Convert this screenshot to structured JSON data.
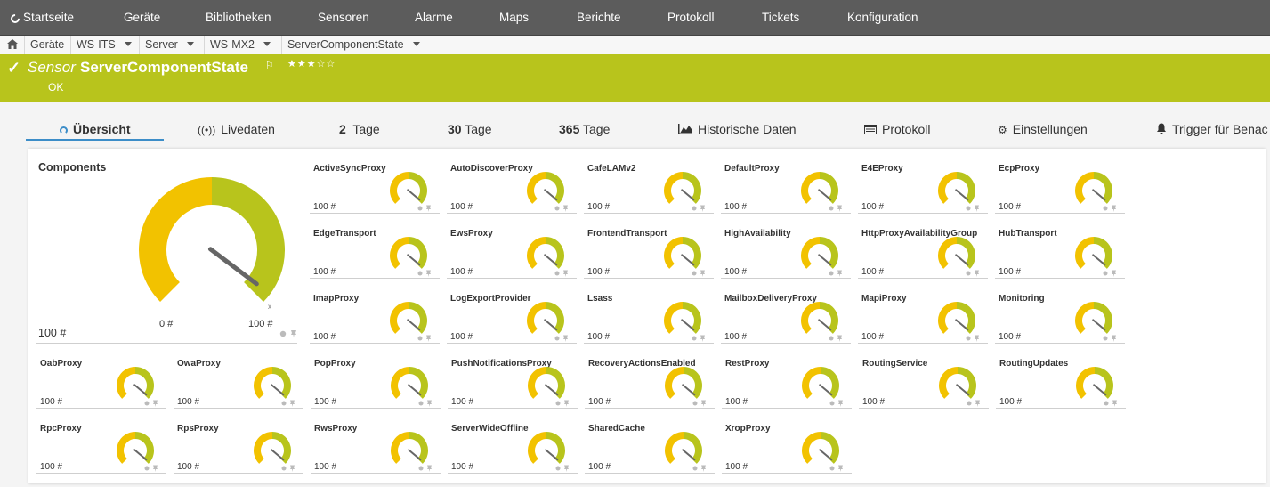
{
  "nav": {
    "items": [
      "Startseite",
      "Geräte",
      "Bibliotheken",
      "Sensoren",
      "Alarme",
      "Maps",
      "Berichte",
      "Protokoll",
      "Tickets",
      "Konfiguration"
    ]
  },
  "breadcrumb": {
    "items": [
      "Geräte",
      "WS-ITS",
      "Server",
      "WS-MX2",
      "ServerComponentState"
    ]
  },
  "header": {
    "kind": "Sensor",
    "name": "ServerComponentState",
    "status": "OK",
    "priority_stars": 3,
    "priority_max": 5
  },
  "tabs": [
    {
      "label": "Übersicht"
    },
    {
      "label": "Livedaten"
    },
    {
      "num": "2",
      "label": "Tage"
    },
    {
      "num": "30",
      "label": "Tage"
    },
    {
      "num": "365",
      "label": "Tage"
    },
    {
      "label": "Historische Daten"
    },
    {
      "label": "Protokoll"
    },
    {
      "label": "Einstellungen"
    },
    {
      "label": "Trigger für Benac"
    }
  ],
  "colors": {
    "brand": "#b8c41c",
    "gauge_ok": "#b8c41c",
    "gauge_warn": "#f2c200",
    "needle": "#666666",
    "nav_bg": "#5c5c5c"
  },
  "main_gauge": {
    "title": "Components",
    "value": "100 #",
    "min_label": "0 #",
    "max_label": "100 #",
    "level": 1.0
  },
  "channels": [
    {
      "name": "ActiveSyncProxy",
      "value": "100 #"
    },
    {
      "name": "AutoDiscoverProxy",
      "value": "100 #"
    },
    {
      "name": "CafeLAMv2",
      "value": "100 #"
    },
    {
      "name": "DefaultProxy",
      "value": "100 #"
    },
    {
      "name": "E4EProxy",
      "value": "100 #"
    },
    {
      "name": "EcpProxy",
      "value": "100 #"
    },
    {
      "name": "EdgeTransport",
      "value": "100 #"
    },
    {
      "name": "EwsProxy",
      "value": "100 #"
    },
    {
      "name": "FrontendTransport",
      "value": "100 #"
    },
    {
      "name": "HighAvailability",
      "value": "100 #"
    },
    {
      "name": "HttpProxyAvailabilityGroup",
      "value": "100 #"
    },
    {
      "name": "HubTransport",
      "value": "100 #"
    },
    {
      "name": "ImapProxy",
      "value": "100 #"
    },
    {
      "name": "LogExportProvider",
      "value": "100 #"
    },
    {
      "name": "Lsass",
      "value": "100 #"
    },
    {
      "name": "MailboxDeliveryProxy",
      "value": "100 #"
    },
    {
      "name": "MapiProxy",
      "value": "100 #"
    },
    {
      "name": "Monitoring",
      "value": "100 #"
    },
    {
      "name": "OabProxy",
      "value": "100 #"
    },
    {
      "name": "OwaProxy",
      "value": "100 #"
    },
    {
      "name": "PopProxy",
      "value": "100 #"
    },
    {
      "name": "PushNotificationsProxy",
      "value": "100 #"
    },
    {
      "name": "RecoveryActionsEnabled",
      "value": "100 #"
    },
    {
      "name": "RestProxy",
      "value": "100 #"
    },
    {
      "name": "RoutingService",
      "value": "100 #"
    },
    {
      "name": "RoutingUpdates",
      "value": "100 #"
    },
    {
      "name": "RpcProxy",
      "value": "100 #"
    },
    {
      "name": "RpsProxy",
      "value": "100 #"
    },
    {
      "name": "RwsProxy",
      "value": "100 #"
    },
    {
      "name": "ServerWideOffline",
      "value": "100 #"
    },
    {
      "name": "SharedCache",
      "value": "100 #"
    },
    {
      "name": "XropProxy",
      "value": "100 #"
    }
  ]
}
